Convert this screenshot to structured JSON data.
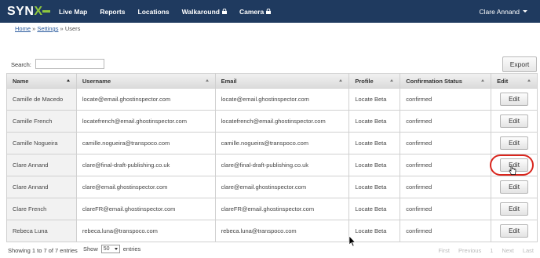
{
  "nav": {
    "logo_main": "SYN",
    "logo_accent": "X",
    "items": [
      {
        "label": "Live Map",
        "locked": false
      },
      {
        "label": "Reports",
        "locked": false
      },
      {
        "label": "Locations",
        "locked": false
      },
      {
        "label": "Walkaround",
        "locked": true
      },
      {
        "label": "Camera",
        "locked": true
      }
    ],
    "user": "Clare Annand"
  },
  "breadcrumb": {
    "home": "Home",
    "sep1": " » ",
    "settings": "Settings",
    "sep2": " » ",
    "current": "Users"
  },
  "search": {
    "label": "Search:",
    "value": ""
  },
  "export_label": "Export",
  "table": {
    "headers": [
      "Name",
      "Username",
      "Email",
      "Profile",
      "Confirmation Status",
      "Edit"
    ],
    "rows": [
      {
        "name": "Camille de Macedo",
        "username": "locate@email.ghostinspector.com",
        "email": "locate@email.ghostinspector.com",
        "profile": "Locate Beta",
        "status": "confirmed",
        "edit": "Edit"
      },
      {
        "name": "Camille French",
        "username": "locatefrench@email.ghostinspector.com",
        "email": "locatefrench@email.ghostinspector.com",
        "profile": "Locate Beta",
        "status": "confirmed",
        "edit": "Edit"
      },
      {
        "name": "Camille Nogueira",
        "username": "camille.nogueira@transpoco.com",
        "email": "camille.nogueira@transpoco.com",
        "profile": "Locate Beta",
        "status": "confirmed",
        "edit": "Edit"
      },
      {
        "name": "Clare Annand",
        "username": "clare@final-draft-publishing.co.uk",
        "email": "clare@final-draft-publishing.co.uk",
        "profile": "Locate Beta",
        "status": "confirmed",
        "edit": "Edit"
      },
      {
        "name": "Clare Annand",
        "username": "clare@email.ghostinspector.com",
        "email": "clare@email.ghostinspector.com",
        "profile": "Locate Beta",
        "status": "confirmed",
        "edit": "Edit"
      },
      {
        "name": "Clare French",
        "username": "clareFR@email.ghostinspector.com",
        "email": "clareFR@email.ghostinspector.com",
        "profile": "Locate Beta",
        "status": "confirmed",
        "edit": "Edit"
      },
      {
        "name": "Rebeca Luna",
        "username": "rebeca.luna@transpoco.com",
        "email": "rebeca.luna@transpoco.com",
        "profile": "Locate Beta",
        "status": "confirmed",
        "edit": "Edit"
      }
    ]
  },
  "footer": {
    "info": "Showing 1 to 7 of 7 entries",
    "show": "Show",
    "length_value": "50",
    "entries": "entries",
    "pager": [
      "First",
      "Previous",
      "1",
      "Next",
      "Last"
    ]
  },
  "colors": {
    "nav_bg": "#1f3a5f",
    "logo_accent": "#8ec63f",
    "highlight": "#d9251d"
  }
}
